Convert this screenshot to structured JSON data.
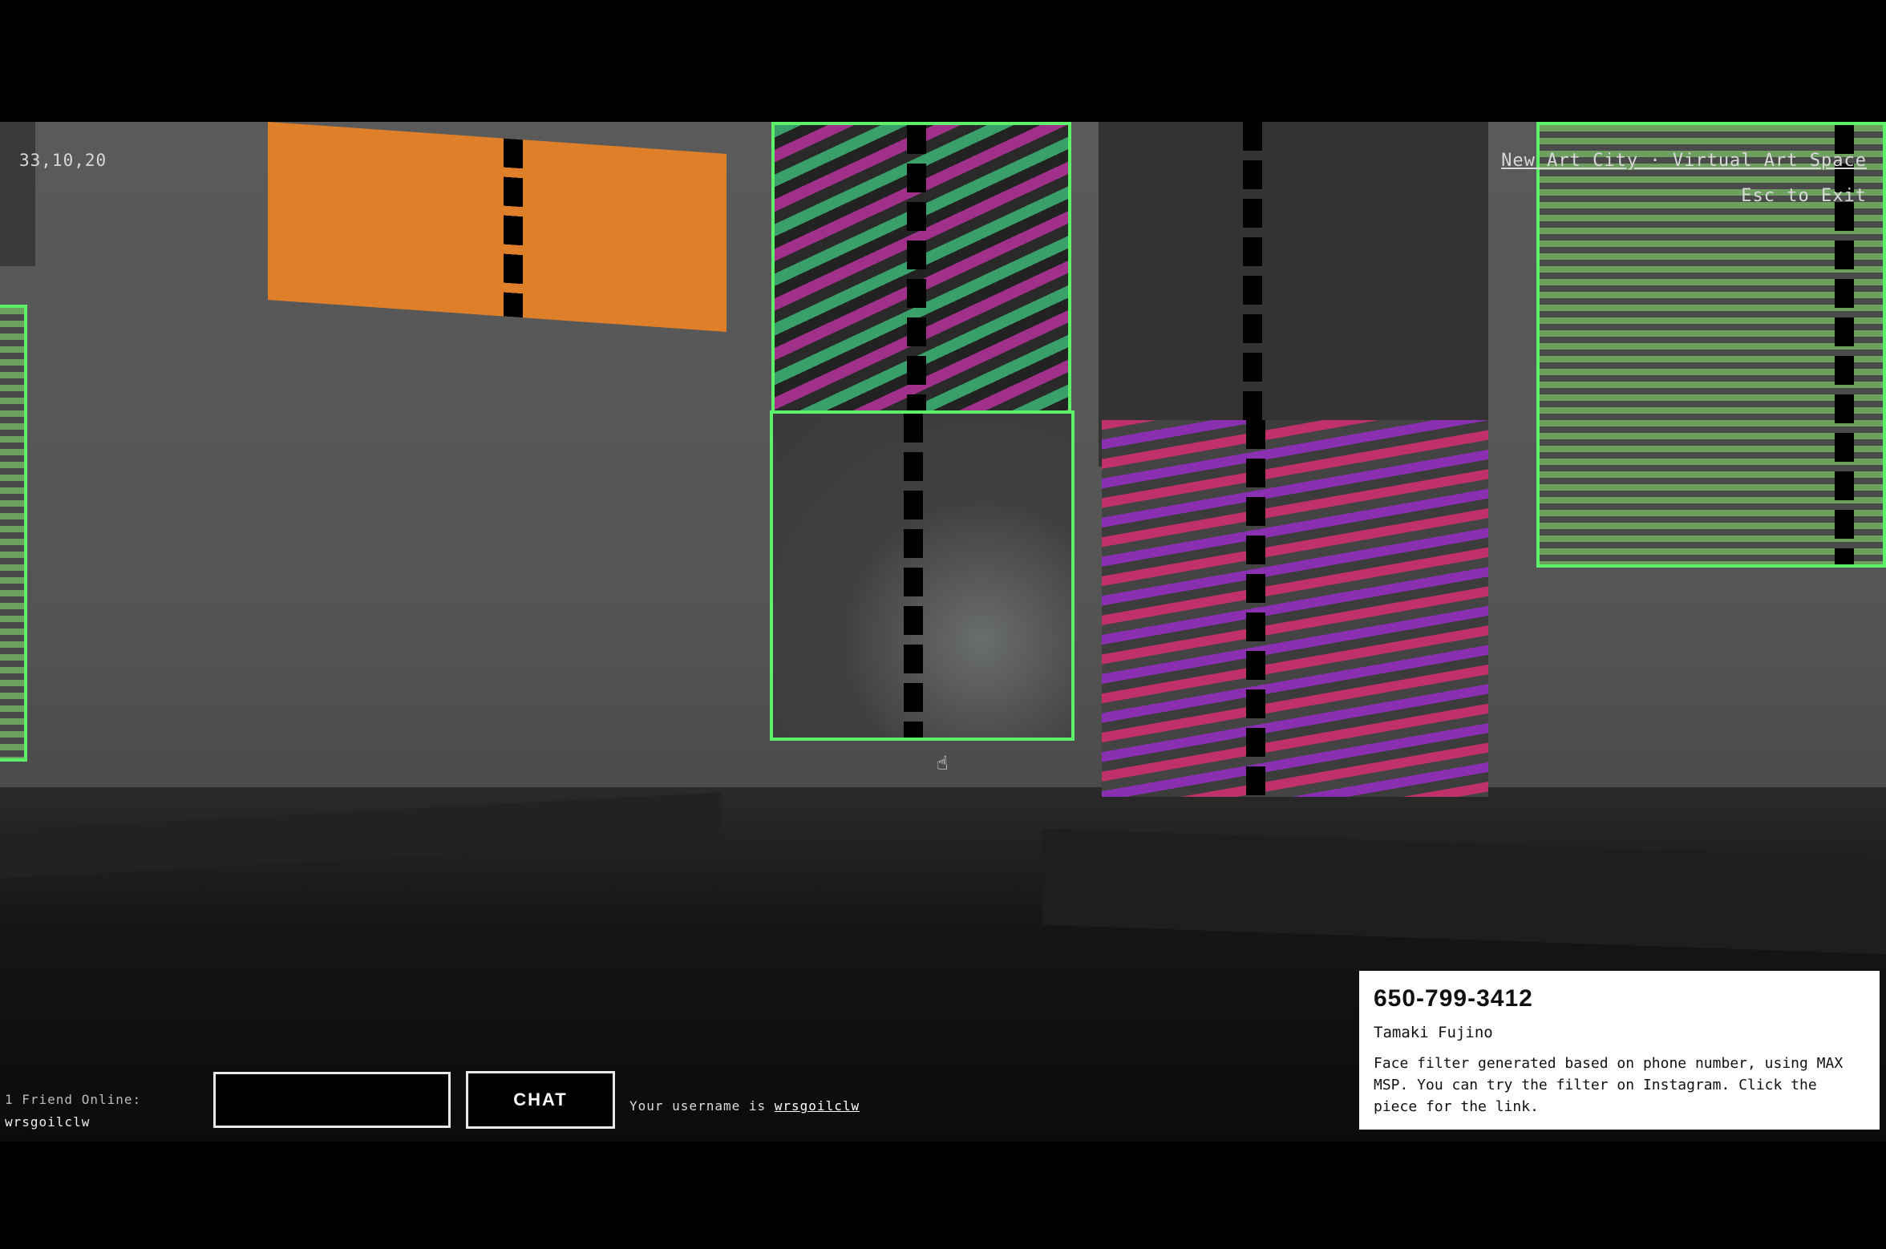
{
  "hud": {
    "coordinates": "33,10,20",
    "title_link": "New Art City · Virtual Art Space",
    "exit_hint": "Esc to Exit"
  },
  "friends": {
    "count_label": "1 Friend Online:",
    "names": [
      "wrsgoilclw"
    ]
  },
  "chat": {
    "input_value": "",
    "button_label": "CHAT",
    "username_prefix": "Your username is",
    "username": "wrsgoilclw"
  },
  "info_card": {
    "title": "650-799-3412",
    "artist": "Tamaki Fujino",
    "description": "Face filter generated based on phone number, using MAX MSP. You can try the filter on Instagram. Click the piece for the link."
  },
  "colors": {
    "highlight_frame": "#5ff06a",
    "orange_panel": "#e07f2a"
  }
}
